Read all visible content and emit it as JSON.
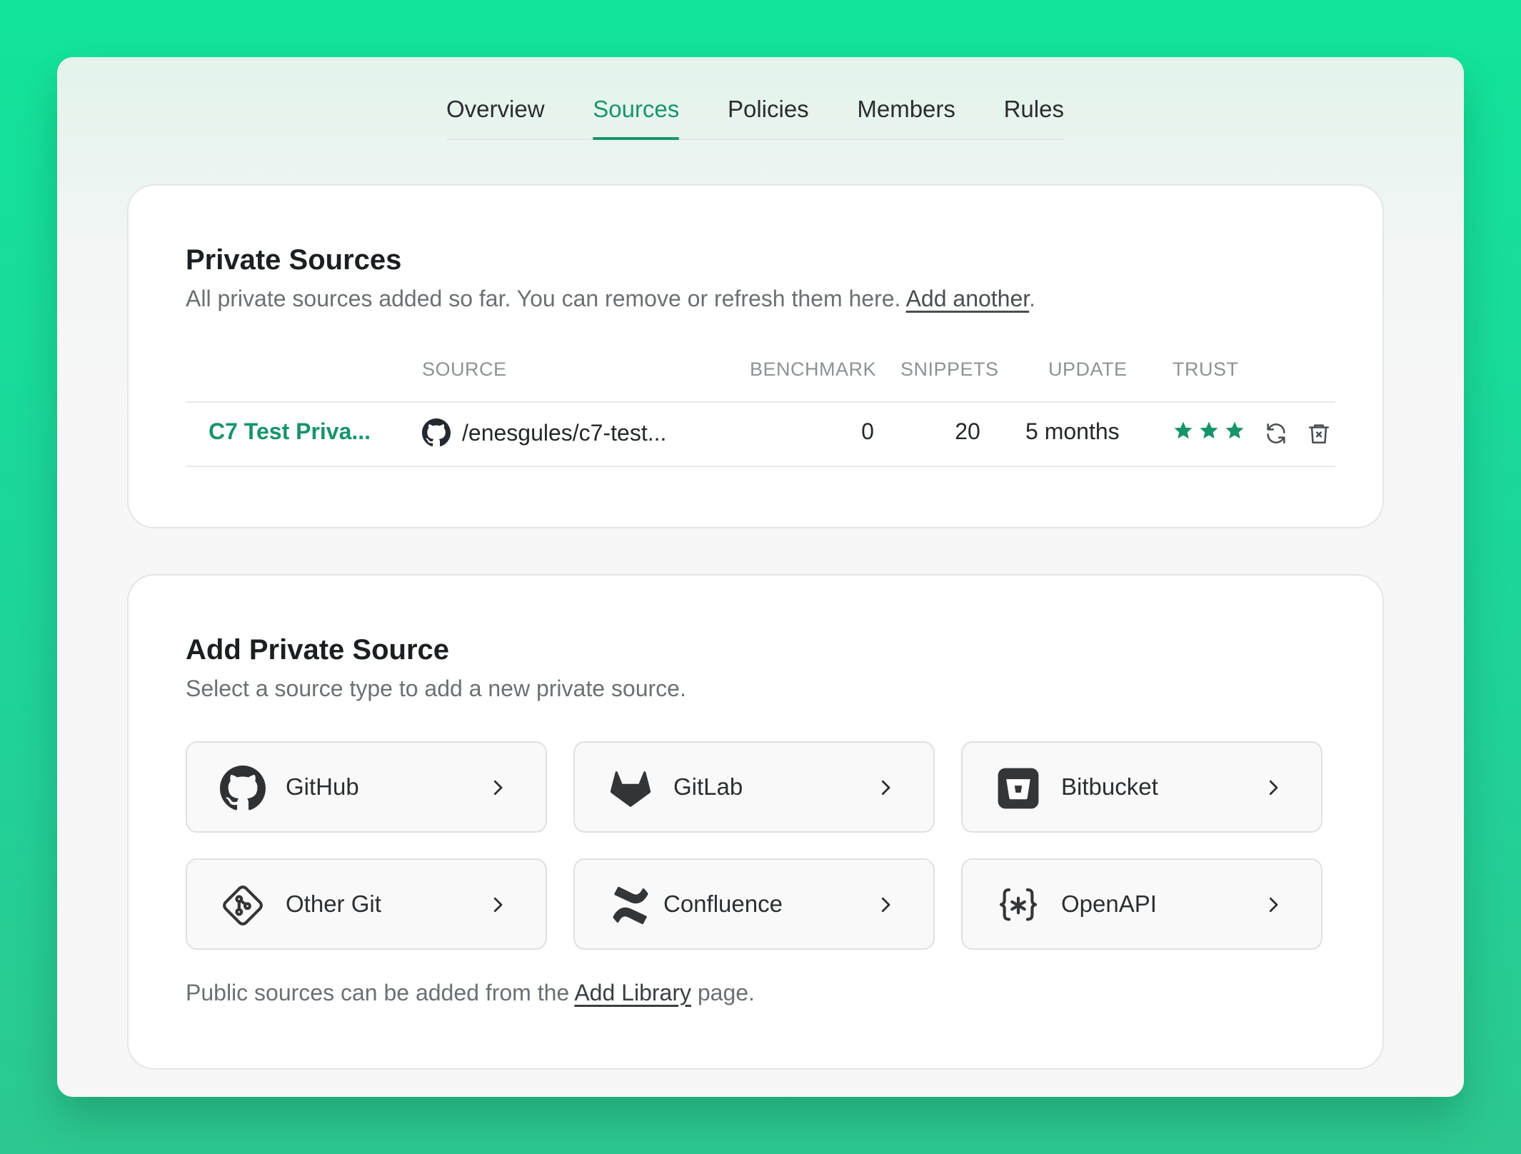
{
  "tabs": [
    {
      "label": "Overview"
    },
    {
      "label": "Sources"
    },
    {
      "label": "Policies"
    },
    {
      "label": "Members"
    },
    {
      "label": "Rules"
    }
  ],
  "private_sources": {
    "title": "Private Sources",
    "subtitle": "All private sources added so far. You can remove or refresh them here.",
    "add_link": "Add another",
    "subtitle_end": ".",
    "columns": {
      "source": "SOURCE",
      "benchmark": "BENCHMARK",
      "snippets": "SNIPPETS",
      "update": "UPDATE",
      "trust": "TRUST"
    },
    "rows": [
      {
        "name": "C7 Test Priva...",
        "source": "/enesgules/c7-test...",
        "benchmark": "0",
        "snippets": "20",
        "update": "5 months",
        "trust_stars": 3,
        "source_icon": "github-icon"
      }
    ]
  },
  "add_source": {
    "title": "Add Private Source",
    "subtitle": "Select a source type to add a new private source.",
    "types": [
      {
        "label": "GitHub",
        "icon": "github-icon"
      },
      {
        "label": "GitLab",
        "icon": "gitlab-icon"
      },
      {
        "label": "Bitbucket",
        "icon": "bitbucket-icon"
      },
      {
        "label": "Other Git",
        "icon": "git-icon"
      },
      {
        "label": "Confluence",
        "icon": "confluence-icon"
      },
      {
        "label": "OpenAPI",
        "icon": "openapi-icon"
      }
    ],
    "footer_pre": "Public sources can be added from the ",
    "footer_link": "Add Library",
    "footer_post": " page."
  },
  "colors": {
    "accent": "#17956a",
    "background": "#12e49b"
  }
}
